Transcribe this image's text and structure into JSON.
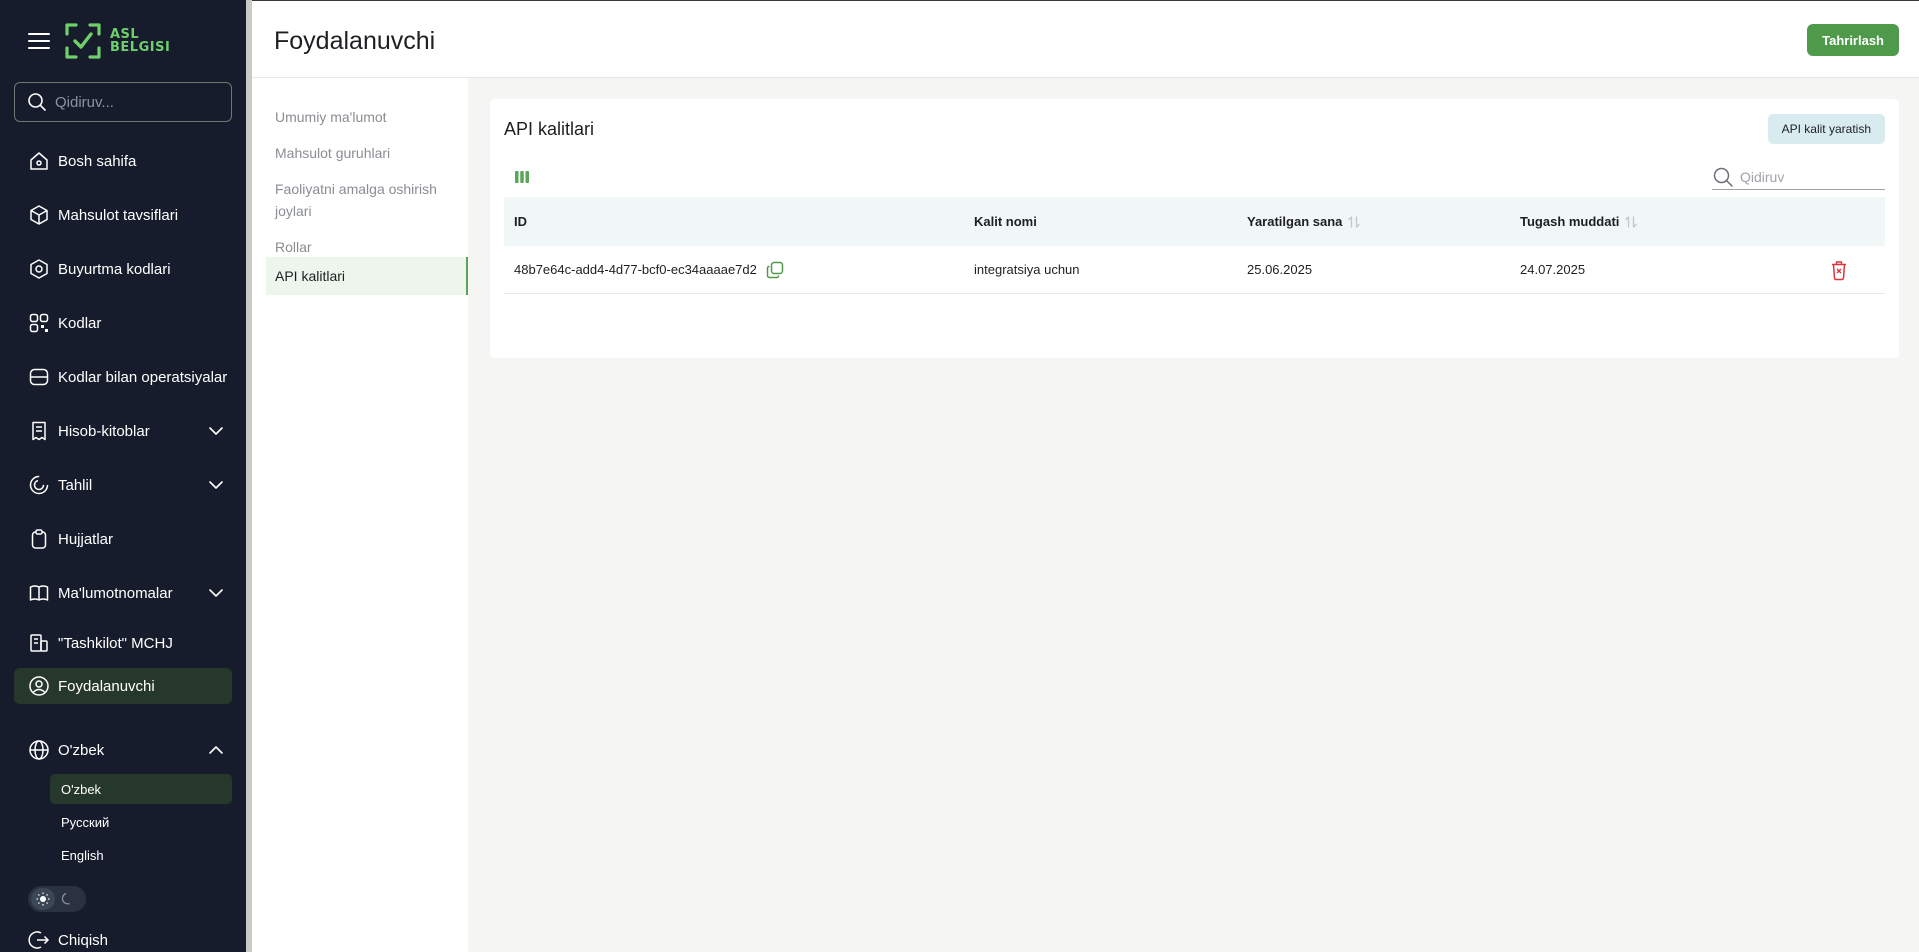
{
  "brand": {
    "logo_line1": "ASL",
    "logo_line2": "BELGISI"
  },
  "sidebar": {
    "search_placeholder": "Qidiruv...",
    "items": [
      {
        "label": "Bosh sahifa",
        "icon": "home-icon"
      },
      {
        "label": "Mahsulot tavsiflari",
        "icon": "box-icon"
      },
      {
        "label": "Buyurtma kodlari",
        "icon": "box-gear-icon"
      },
      {
        "label": "Kodlar",
        "icon": "qr-code-icon"
      },
      {
        "label": "Kodlar bilan operatsiyalar",
        "icon": "scan-icon"
      },
      {
        "label": "Hisob-kitoblar",
        "icon": "receipt-icon"
      },
      {
        "label": "Tahlil",
        "icon": "analytics-icon"
      },
      {
        "label": "Hujjatlar",
        "icon": "clipboard-icon"
      },
      {
        "label": "Ma'lumotnomalar",
        "icon": "book-icon"
      },
      {
        "label": "\"Tashkilot\" MCHJ",
        "icon": "building-icon"
      },
      {
        "label": "Foydalanuvchi",
        "icon": "user-icon"
      }
    ],
    "language": {
      "label": "O'zbek",
      "options": [
        "O'zbek",
        "Русский",
        "English"
      ],
      "selected": "O'zbek"
    },
    "logout_label": "Chiqish"
  },
  "header": {
    "title": "Foydalanuvchi",
    "edit_label": "Tahrirlash"
  },
  "subnav": {
    "items": [
      "Umumiy ma'lumot",
      "Mahsulot guruhlari",
      "Faoliyatni amalga oshirish joylari",
      "Rollar",
      "API kalitlari"
    ],
    "active": "API kalitlari"
  },
  "api_keys": {
    "title": "API kalitlari",
    "create_label": "API kalit yaratish",
    "search_placeholder": "Qidiruv",
    "columns": {
      "id": "ID",
      "name": "Kalit nomi",
      "created": "Yaratilgan sana",
      "expires": "Tugash muddati"
    },
    "rows": [
      {
        "id": "48b7e64c-add4-4d77-bcf0-ec34aaaae7d2",
        "name": "integratsiya uchun",
        "created": "25.06.2025",
        "expires": "24.07.2025"
      }
    ]
  },
  "colors": {
    "sidebar_bg": "#161c2c",
    "accent_green": "#4f9a4a",
    "active_bg": "#26382b",
    "danger": "#d9363e"
  }
}
